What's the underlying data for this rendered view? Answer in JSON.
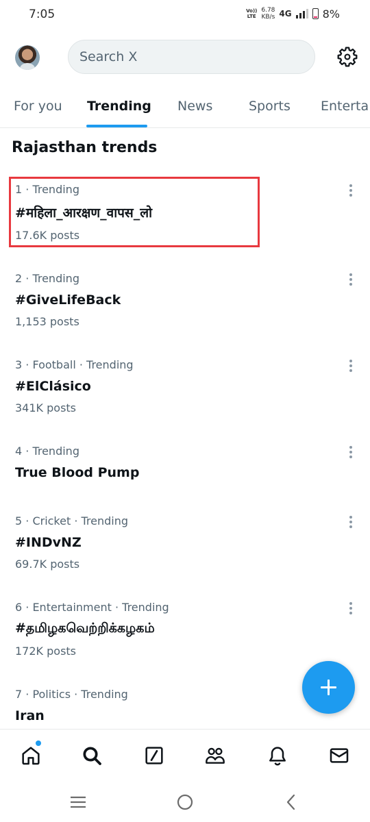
{
  "status_bar": {
    "time": "7:05",
    "volte": "Vo)) LTE",
    "speed_value": "6.78",
    "speed_unit": "KB/s",
    "network": "4G",
    "battery": "8%"
  },
  "header": {
    "search_placeholder": "Search X",
    "avatar_icon": "user-avatar",
    "settings_icon": "gear-icon"
  },
  "tabs": [
    {
      "label": "For you",
      "active": false
    },
    {
      "label": "Trending",
      "active": true
    },
    {
      "label": "News",
      "active": false
    },
    {
      "label": "Sports",
      "active": false
    },
    {
      "label": "Enterta",
      "active": false
    }
  ],
  "section": {
    "title": "Rajasthan trends"
  },
  "trends": [
    {
      "meta": "1 · Trending",
      "name": "#महिला_आरक्षण_वापस_लो",
      "count": "17.6K posts"
    },
    {
      "meta": "2 · Trending",
      "name": "#GiveLifeBack",
      "count": "1,153 posts"
    },
    {
      "meta": "3 · Football · Trending",
      "name": "#ElClásico",
      "count": "341K posts"
    },
    {
      "meta": "4 · Trending",
      "name": "True Blood Pump",
      "count": ""
    },
    {
      "meta": "5 · Cricket · Trending",
      "name": "#INDvNZ",
      "count": "69.7K posts"
    },
    {
      "meta": "6 · Entertainment · Trending",
      "name": "#தமிழகவெற்றிக்கழகம்",
      "count": "172K posts"
    },
    {
      "meta": "7 · Politics · Trending",
      "name": "Iran",
      "count": ""
    }
  ],
  "colors": {
    "accent": "#1d9bf0",
    "highlight_box": "#e8393f",
    "text_primary": "#0f1419",
    "text_secondary": "#536471"
  },
  "fab": {
    "icon": "plus-icon"
  },
  "bottom_nav": {
    "items": [
      "home-icon",
      "search-icon",
      "grok-icon",
      "communities-icon",
      "notifications-icon",
      "messages-icon"
    ],
    "active": "search-icon"
  },
  "system_nav": {
    "items": [
      "recents-icon",
      "home-circle-icon",
      "back-icon"
    ]
  }
}
